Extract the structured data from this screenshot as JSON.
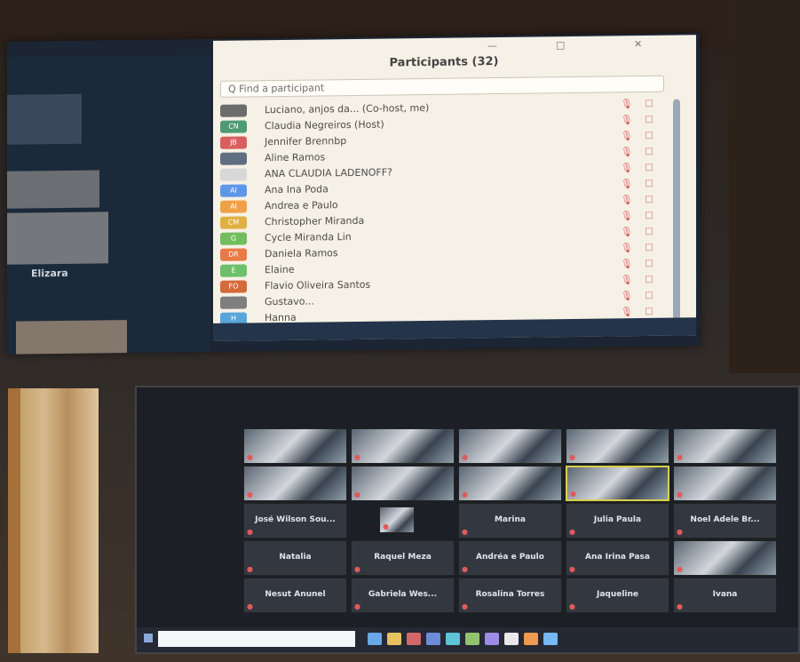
{
  "participants_window": {
    "title": "Participants (32)",
    "search_placeholder": "Q Find a participant",
    "window_controls": [
      "—",
      "□",
      "✕"
    ],
    "left_label": "Elizara",
    "rows": [
      {
        "avatar": "",
        "name": "Luciano, anjos da... (Co-host, me)",
        "mic": "🎙",
        "cam": "□"
      },
      {
        "avatar": "CN",
        "name": "Claudia Negreiros (Host)",
        "mic": "🎙",
        "cam": "□"
      },
      {
        "avatar": "JB",
        "name": "Jennifer Brennbp",
        "mic": "🎙",
        "cam": "□"
      },
      {
        "avatar": "",
        "name": "Aline Ramos",
        "mic": "🎙",
        "cam": "□"
      },
      {
        "avatar": "",
        "name": "ANA CLAUDIA LADENOFF?",
        "mic": "🎙",
        "cam": "□"
      },
      {
        "avatar": "AI",
        "name": "Ana Ina Poda",
        "mic": "🎙",
        "cam": "□"
      },
      {
        "avatar": "AI",
        "name": "Andrea e Paulo",
        "mic": "🎙",
        "cam": "□"
      },
      {
        "avatar": "CM",
        "name": "Christopher Miranda",
        "mic": "🎙",
        "cam": "□"
      },
      {
        "avatar": "G",
        "name": "Cycle Miranda Lin",
        "mic": "🎙",
        "cam": "□"
      },
      {
        "avatar": "DR",
        "name": "Daniela Ramos",
        "mic": "🎙",
        "cam": "□"
      },
      {
        "avatar": "E",
        "name": "Elaine",
        "mic": "🎙",
        "cam": "□"
      },
      {
        "avatar": "FO",
        "name": "Flavio Oliveira Santos",
        "mic": "🎙",
        "cam": "□"
      },
      {
        "avatar": "",
        "name": "Gustavo...",
        "mic": "🎙",
        "cam": "□"
      },
      {
        "avatar": "H",
        "name": "Hanna",
        "mic": "🎙",
        "cam": "□"
      }
    ],
    "avatar_colors": [
      "#6c6c6c",
      "#4e9b73",
      "#d95f5f",
      "#5f6f81",
      "#d8d8d8",
      "#5d97e8",
      "#f0a148",
      "#e0b044",
      "#72bd5d",
      "#e77a46",
      "#6cc06a",
      "#d56b3b",
      "#7f7f7f",
      "#58a5da"
    ]
  },
  "video_grid": {
    "tiles": [
      {
        "name": "",
        "mode": "video"
      },
      {
        "name": "",
        "mode": "video"
      },
      {
        "name": "",
        "mode": "video"
      },
      {
        "name": "",
        "mode": "video"
      },
      {
        "name": "",
        "mode": "video"
      },
      {
        "name": "",
        "mode": "video"
      },
      {
        "name": "",
        "mode": "video"
      },
      {
        "name": "",
        "mode": "video"
      },
      {
        "name": "",
        "mode": "video",
        "highlight": true
      },
      {
        "name": "",
        "mode": "video"
      },
      {
        "name": "José Wilson Sou...",
        "mode": "name"
      },
      {
        "name": "",
        "mode": "video-small"
      },
      {
        "name": "Marina",
        "mode": "name"
      },
      {
        "name": "Julia Paula",
        "mode": "name"
      },
      {
        "name": "Noel Adele Br...",
        "mode": "name"
      },
      {
        "name": "Natalia",
        "mode": "name"
      },
      {
        "name": "Raquel Meza",
        "mode": "name"
      },
      {
        "name": "Andréa e Paulo",
        "mode": "name"
      },
      {
        "name": "Ana Irina Pasa",
        "mode": "name"
      },
      {
        "name": "",
        "mode": "video"
      },
      {
        "name": "Nesut Anunel",
        "mode": "name"
      },
      {
        "name": "Gabriela Wes...",
        "mode": "name"
      },
      {
        "name": "Rosalina Torres",
        "mode": "name"
      },
      {
        "name": "Jaqueline",
        "mode": "name"
      },
      {
        "name": "Ivana",
        "mode": "name"
      }
    ]
  },
  "taskbar": {
    "search_text": "",
    "clock": "",
    "icons": [
      "#6aa8e8",
      "#e5c25e",
      "#d36868",
      "#6c8cd9",
      "#5dc3d7",
      "#93c26e",
      "#9d8be7",
      "#e9e9e9",
      "#f09a51",
      "#74b9f5"
    ]
  }
}
